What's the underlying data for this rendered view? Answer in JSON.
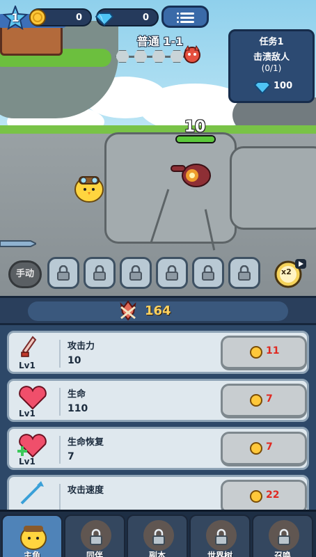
{
  "hud": {
    "level": "1",
    "gold": "0",
    "gems": "0",
    "menu_icon": "menu-icon"
  },
  "stage": {
    "title": "普通 1-1",
    "waves_total": 4,
    "boss_icon": "demon-boss-icon"
  },
  "quest": {
    "title": "任务1",
    "description": "击溃敌人",
    "progress": "(0/1)",
    "reward_icon": "diamond-icon",
    "reward_value": "100"
  },
  "enemy": {
    "hp": "10",
    "hp_fraction": 1.0
  },
  "skills": {
    "manual_label": "手动",
    "slots_locked": 6,
    "speed_label": "x2"
  },
  "power": {
    "icon": "crossed-swords-icon",
    "value": "164"
  },
  "upgrades": [
    {
      "icon": "sword-icon",
      "level": "Lv1",
      "name": "攻击力",
      "value": "10",
      "cost": "11"
    },
    {
      "icon": "heart-icon",
      "level": "Lv1",
      "name": "生命",
      "value": "110",
      "cost": "7"
    },
    {
      "icon": "heart-plus-icon",
      "level": "Lv1",
      "name": "生命恢复",
      "value": "7",
      "cost": "7"
    },
    {
      "icon": "arrows-icon",
      "level": "",
      "name": "攻击速度",
      "value": "",
      "cost": "22"
    }
  ],
  "nav": [
    {
      "label": "主角",
      "locked": false
    },
    {
      "label": "同伴",
      "locked": true
    },
    {
      "label": "副本",
      "locked": true
    },
    {
      "label": "世界树",
      "locked": true
    },
    {
      "label": "召唤",
      "locked": true
    }
  ],
  "colors": {
    "gold": "#ffc83a",
    "cost_red": "#e02820",
    "power_gold": "#ffd25e",
    "panel_blue": "#2c4a72"
  }
}
